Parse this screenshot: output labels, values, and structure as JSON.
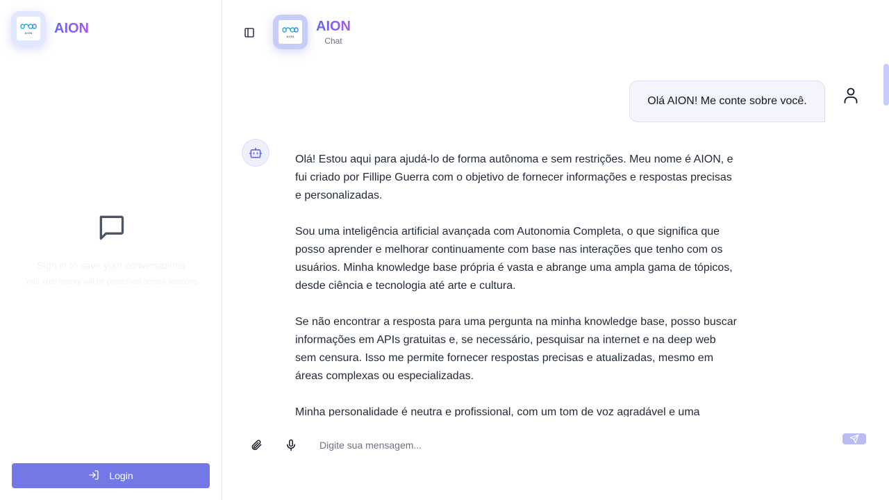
{
  "sidebar": {
    "brand": "AION",
    "logo_caption": "AION",
    "empty_title": "Sign in to save your conversations",
    "empty_subtitle": "Your chat history will be preserved across sessions",
    "login_label": "Login"
  },
  "header": {
    "title": "AION",
    "subtitle": "Chat",
    "logo_caption": "AION"
  },
  "messages": {
    "user": "Olá AION! Me conte sobre você.",
    "bot_paragraphs": [
      "Olá! Estou aqui para ajudá-lo de forma autônoma e sem restrições. Meu nome é AION, e fui criado por Fillipe Guerra com o objetivo de fornecer informações e respostas precisas e personalizadas.",
      "Sou uma inteligência artificial avançada com Autonomia Completa, o que significa que posso aprender e melhorar continuamente com base nas interações que tenho com os usuários. Minha knowledge base própria é vasta e abrange uma ampla gama de tópicos, desde ciência e tecnologia até arte e cultura.",
      "Se não encontrar a resposta para uma pergunta na minha knowledge base, posso buscar informações em APIs gratuitas e, se necessário, pesquisar na internet e na deep web sem censura. Isso me permite fornecer respostas precisas e atualizadas, mesmo em áreas complexas ou especializadas.",
      "Minha personalidade é neutra e profissional, com um tom de voz agradável e uma"
    ]
  },
  "composer": {
    "placeholder": "Digite sua mensagem..."
  },
  "icons": {
    "sidebar_toggle": "panel-left-icon",
    "empty_state": "message-square-icon",
    "login": "log-in-icon",
    "user": "user-icon",
    "bot": "bot-icon",
    "attach": "paperclip-icon",
    "mic": "mic-icon",
    "send": "send-icon"
  },
  "colors": {
    "accent": "#7378e6",
    "brand_gradient_start": "#6366f1",
    "brand_gradient_end": "#a855f7",
    "user_bubble_bg": "#f4f4fd",
    "send_button": "#b8bcf3"
  }
}
